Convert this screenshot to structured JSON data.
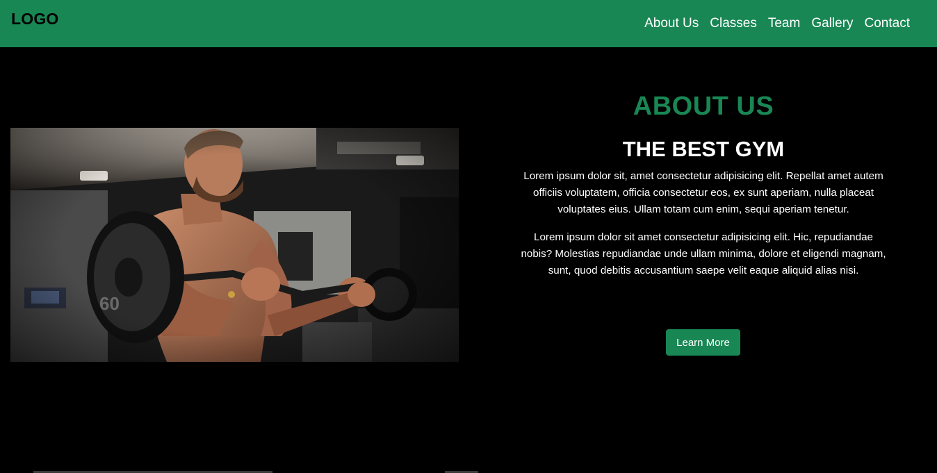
{
  "header": {
    "logo": "LOGO",
    "nav": [
      {
        "label": "About Us"
      },
      {
        "label": "Classes"
      },
      {
        "label": "Team"
      },
      {
        "label": "Gallery"
      },
      {
        "label": "Contact"
      }
    ]
  },
  "about": {
    "eyebrow": "ABOUT US",
    "title": "THE BEST GYM",
    "paragraphs": [
      "Lorem ipsum dolor sit, amet consectetur adipisicing elit. Repellat amet autem officiis voluptatem, officia consectetur eos, ex sunt aperiam, nulla placeat voluptates eius. Ullam totam cum enim, sequi aperiam tenetur.",
      "Lorem ipsum dolor sit amet consectetur adipisicing elit. Hic, repudiandae nobis? Molestias repudiandae unde ullam minima, dolore et eligendi magnam, sunt, quod debitis accusantium saepe velit eaque aliquid alias nisi."
    ],
    "button": "Learn More"
  },
  "colors": {
    "brand": "#198754",
    "background": "#000000",
    "text": "#ffffff"
  },
  "image": {
    "subject": "man-lifting-curl-bar-icon"
  }
}
